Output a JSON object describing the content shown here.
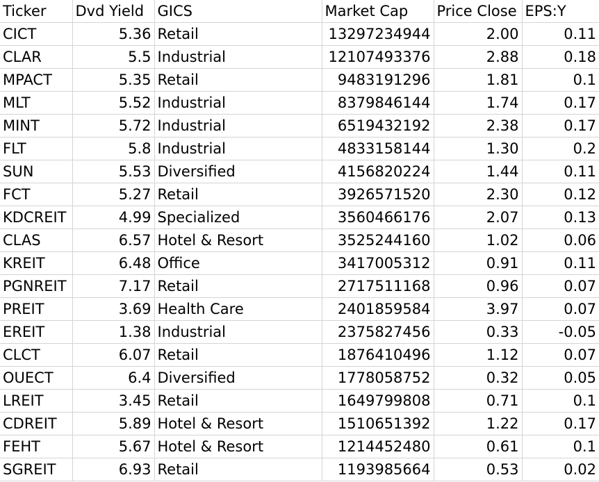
{
  "headers": [
    "Ticker",
    "Dvd Yield",
    "GICS",
    "Market Cap",
    "Price Close",
    "EPS:Y"
  ],
  "rows": [
    [
      "CICT",
      "5.36",
      "Retail",
      "13297234944",
      "2.00",
      "0.11"
    ],
    [
      "CLAR",
      "5.5",
      "Industrial",
      "12107493376",
      "2.88",
      "0.18"
    ],
    [
      "MPACT",
      "5.35",
      "Retail",
      "9483191296",
      "1.81",
      "0.1"
    ],
    [
      "MLT",
      "5.52",
      "Industrial",
      "8379846144",
      "1.74",
      "0.17"
    ],
    [
      "MINT",
      "5.72",
      "Industrial",
      "6519432192",
      "2.38",
      "0.17"
    ],
    [
      "FLT",
      "5.8",
      "Industrial",
      "4833158144",
      "1.30",
      "0.2"
    ],
    [
      "SUN",
      "5.53",
      "Diversified",
      "4156820224",
      "1.44",
      "0.11"
    ],
    [
      "FCT",
      "5.27",
      "Retail",
      "3926571520",
      "2.30",
      "0.12"
    ],
    [
      "KDCREIT",
      "4.99",
      "Specialized",
      "3560466176",
      "2.07",
      "0.13"
    ],
    [
      "CLAS",
      "6.57",
      "Hotel & Resort",
      "3525244160",
      "1.02",
      "0.06"
    ],
    [
      "KREIT",
      "6.48",
      "Office",
      "3417005312",
      "0.91",
      "0.11"
    ],
    [
      "PGNREIT",
      "7.17",
      "Retail",
      "2717511168",
      "0.96",
      "0.07"
    ],
    [
      "PREIT",
      "3.69",
      "Health Care",
      "2401859584",
      "3.97",
      "0.07"
    ],
    [
      "EREIT",
      "1.38",
      "Industrial",
      "2375827456",
      "0.33",
      "-0.05"
    ],
    [
      "CLCT",
      "6.07",
      "Retail",
      "1876410496",
      "1.12",
      "0.07"
    ],
    [
      "OUECT",
      "6.4",
      "Diversified",
      "1778058752",
      "0.32",
      "0.05"
    ],
    [
      "LREIT",
      "3.45",
      "Retail",
      "1649799808",
      "0.71",
      "0.1"
    ],
    [
      "CDREIT",
      "5.89",
      "Hotel & Resort",
      "1510651392",
      "1.22",
      "0.17"
    ],
    [
      "FEHT",
      "5.67",
      "Hotel & Resort",
      "1214452480",
      "0.61",
      "0.1"
    ],
    [
      "SGREIT",
      "6.93",
      "Retail",
      "1193985664",
      "0.53",
      "0.02"
    ]
  ]
}
